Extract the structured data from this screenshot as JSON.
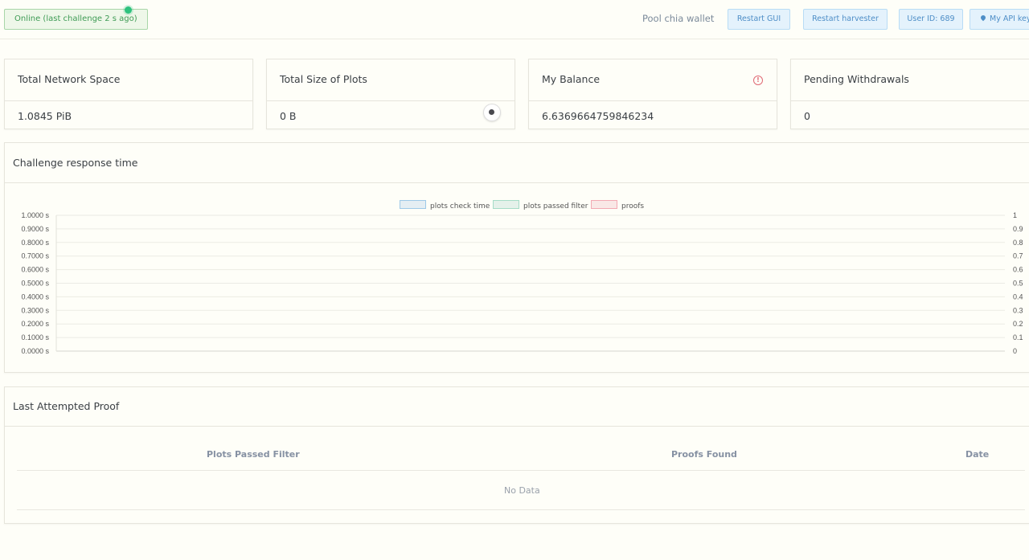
{
  "header": {
    "status": "Online (last challenge 2 s ago)",
    "pool_wallet": "Pool chia wallet",
    "buttons": {
      "restart_gui": "Restart GUI",
      "restart_harvester": "Restart harvester",
      "user_id": "User ID: 689",
      "api_key": "My API key"
    }
  },
  "stats": {
    "network_space": {
      "title": "Total Network Space",
      "value": "1.0845 PiB"
    },
    "plots_size": {
      "title": "Total Size of Plots",
      "value": "0 B"
    },
    "balance": {
      "title": "My Balance",
      "value": "6.6369664759846234"
    },
    "withdrawals": {
      "title": "Pending Withdrawals",
      "value": "0"
    }
  },
  "challenge_panel": {
    "title": "Challenge response time"
  },
  "chart_data": {
    "type": "line",
    "legend": [
      {
        "name": "plots check time",
        "color": "#9ec9e8"
      },
      {
        "name": "plots passed filter",
        "color": "#a6dcc7"
      },
      {
        "name": "proofs",
        "color": "#f2a9b3"
      }
    ],
    "series": [
      {
        "name": "plots check time",
        "values": []
      },
      {
        "name": "plots passed filter",
        "values": []
      },
      {
        "name": "proofs",
        "values": []
      }
    ],
    "y_left_ticks": [
      "1.0000 s",
      "0.9000 s",
      "0.8000 s",
      "0.7000 s",
      "0.6000 s",
      "0.5000 s",
      "0.4000 s",
      "0.3000 s",
      "0.2000 s",
      "0.1000 s",
      "0.0000 s"
    ],
    "y_right_ticks": [
      "1",
      "0.9",
      "0.8",
      "0.7",
      "0.6",
      "0.5",
      "0.4",
      "0.3",
      "0.2",
      "0.1",
      "0"
    ],
    "ylim_left": [
      0,
      1
    ],
    "ylim_right": [
      0,
      1
    ],
    "grid": true,
    "legend_position": "top"
  },
  "proof_panel": {
    "title": "Last Attempted Proof",
    "columns": [
      "Plots Passed Filter",
      "Proofs Found",
      "Date"
    ],
    "empty_text": "No Data"
  }
}
